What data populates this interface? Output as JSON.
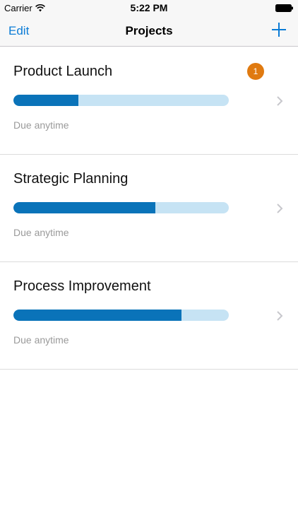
{
  "status_bar": {
    "carrier": "Carrier",
    "time": "5:22 PM"
  },
  "nav": {
    "edit_label": "Edit",
    "title": "Projects",
    "add_icon": "plus-icon"
  },
  "colors": {
    "accent": "#0a7bd6",
    "progress_fill": "#0a73b9",
    "progress_track": "#c6e3f4",
    "badge": "#e07a10",
    "muted_text": "#9a9a9a"
  },
  "projects": [
    {
      "name": "Product Launch",
      "due": "Due anytime",
      "progress": 0.3,
      "badge": "1"
    },
    {
      "name": "Strategic Planning",
      "due": "Due anytime",
      "progress": 0.66,
      "badge": null
    },
    {
      "name": "Process Improvement",
      "due": "Due anytime",
      "progress": 0.78,
      "badge": null
    }
  ]
}
